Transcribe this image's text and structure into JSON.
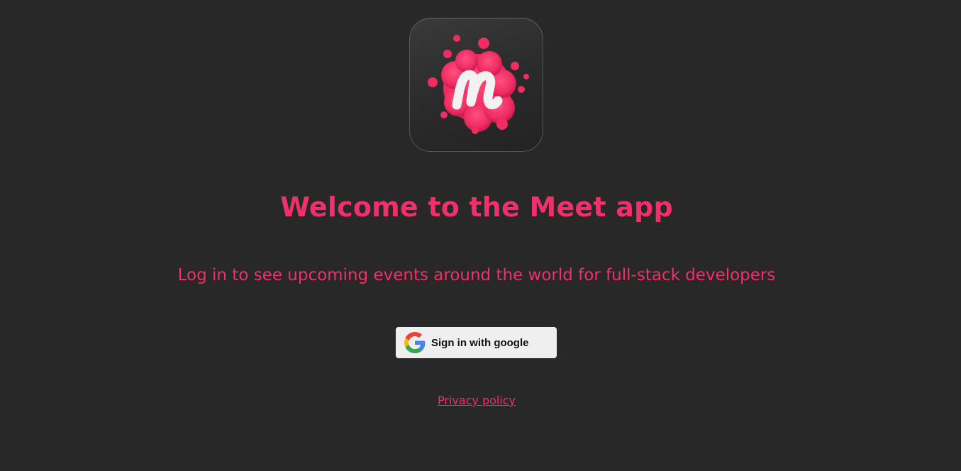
{
  "app": {
    "logo_icon": "meetup-m-splash-icon",
    "logo_letter": "m"
  },
  "header": {
    "title": "Welcome to the Meet app"
  },
  "main": {
    "subtitle": "Log in to see upcoming events around the world for full-stack developers"
  },
  "auth": {
    "google_button_label": "Sign in with google",
    "google_icon": "google-g-icon"
  },
  "footer": {
    "privacy_label": "Privacy policy"
  },
  "colors": {
    "background": "#282828",
    "accent": "#f0306a",
    "button_bg": "#efefef"
  }
}
